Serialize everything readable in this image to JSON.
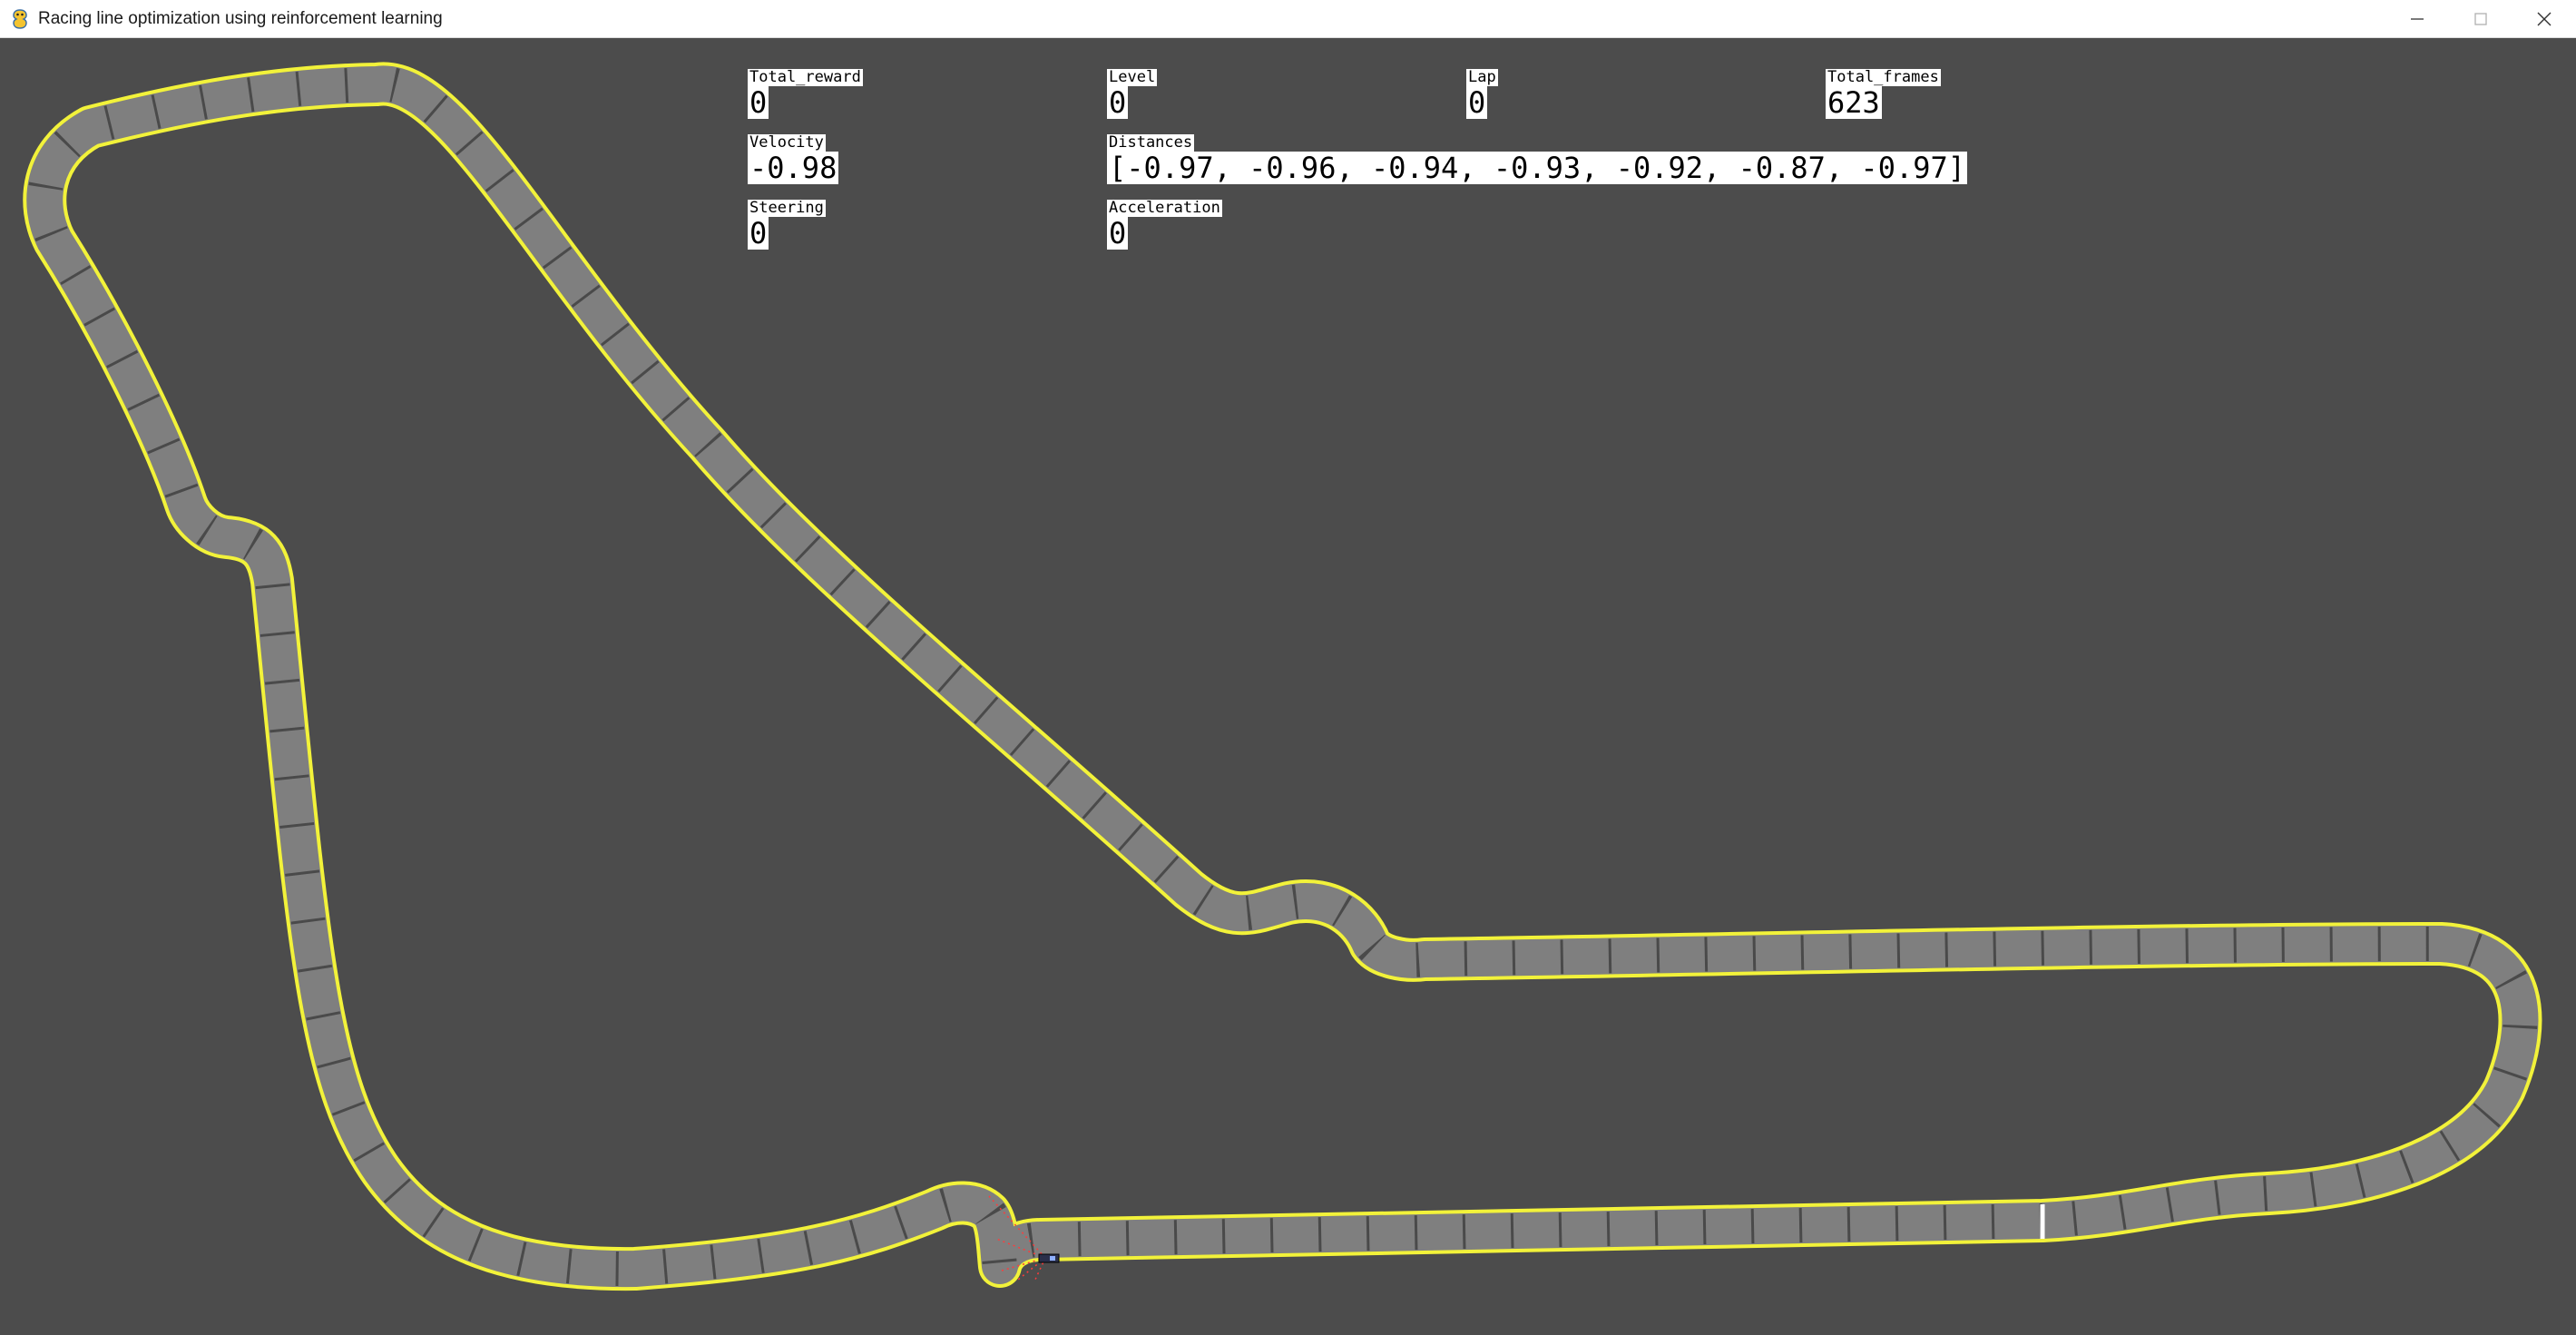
{
  "window": {
    "title": "Racing line optimization using reinforcement learning",
    "app_icon": "pygame-snake-icon",
    "controls": [
      "minimize-icon",
      "maximize-icon",
      "close-icon"
    ]
  },
  "hud": {
    "total_reward": {
      "label": "Total_reward",
      "value": "0"
    },
    "level": {
      "label": "Level",
      "value": "0"
    },
    "lap": {
      "label": "Lap",
      "value": "0"
    },
    "total_frames": {
      "label": "Total_frames",
      "value": "623"
    },
    "velocity": {
      "label": "Velocity",
      "value": "-0.98"
    },
    "distances": {
      "label": "Distances",
      "value": "[-0.97, -0.96, -0.94, -0.93, -0.92, -0.87, -0.97]"
    },
    "steering": {
      "label": "Steering",
      "value": "0"
    },
    "acceleration": {
      "label": "Acceleration",
      "value": "0"
    }
  },
  "colors": {
    "background": "#4c4c4c",
    "track_surface": "#7f7f7f",
    "track_edge": "#f2f23a",
    "track_stripes": "#4a4a4a",
    "finish_line": "#ffffff",
    "sensor_ray": "#ff3b3b",
    "hud_box": "#ffffff"
  }
}
